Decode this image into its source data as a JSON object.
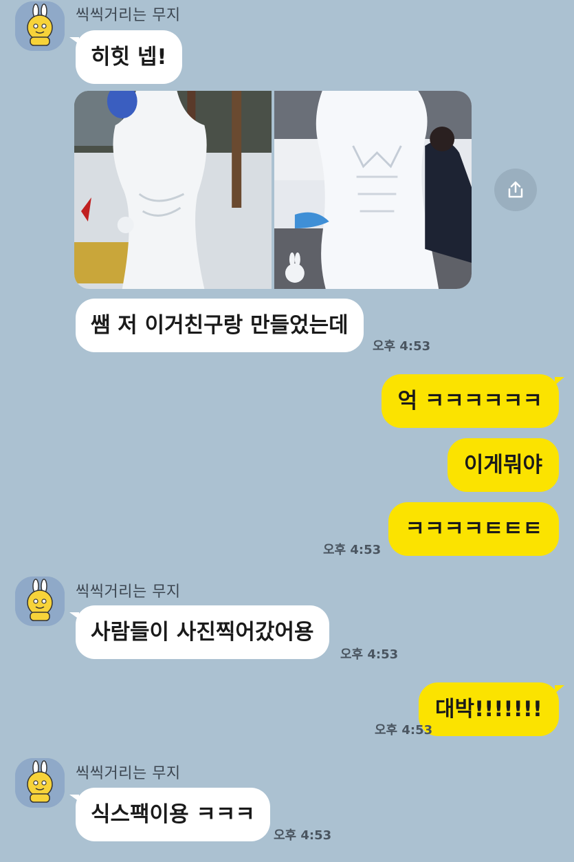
{
  "sender_name": "씩씩거리는 무지",
  "groups": [
    {
      "messages": [
        "히힛 넵!",
        "쌤 저 이거친구랑 만들었는데"
      ],
      "time": "오후 4:53",
      "photo_labels": [
        "photo-left",
        "photo-right"
      ]
    },
    {
      "messages": [
        "억 ㅋㅋㅋㅋㅋㅋ",
        "이게뭐야",
        "ㅋㅋㅋㅋㅌㅌㅌ"
      ],
      "time": "오후 4:53"
    },
    {
      "messages": [
        "사람들이 사진찍어갔어용"
      ],
      "time": "오후 4:53"
    },
    {
      "messages": [
        "대박!!!!!!!"
      ],
      "time": "오후 4:53"
    },
    {
      "messages": [
        "식스팩이용 ㅋㅋㅋ"
      ],
      "time": "오후 4:53"
    }
  ],
  "icons": {
    "share": "share-icon",
    "avatar": "muzi-avatar-icon"
  },
  "colors": {
    "background": "#abc1d1",
    "incoming_bubble": "#ffffff",
    "outgoing_bubble": "#fbe300"
  }
}
